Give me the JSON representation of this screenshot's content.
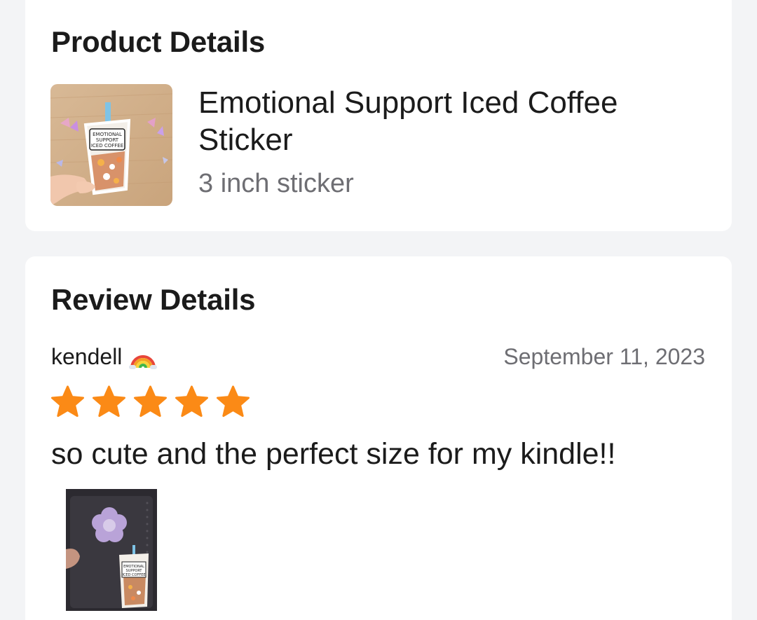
{
  "product_section": {
    "title": "Product Details",
    "product_name": "Emotional Support Iced Coffee Sticker",
    "variant": "3 inch sticker",
    "thumbnail_alt": "Emotional Support Iced Coffee sticker held in hand",
    "sticker_text": [
      "EMOTIONAL",
      "SUPPORT",
      "ICED COFFEE"
    ]
  },
  "review_section": {
    "title": "Review Details",
    "reviewer_name": "kendell",
    "reviewer_emoji": "rainbow-emoji",
    "date": "September 11, 2023",
    "rating": 5,
    "rating_max": 5,
    "review_text": "so cute and the perfect size for my kindle!!",
    "photo_alt": "Sticker applied on a kindle case"
  },
  "colors": {
    "background": "#f3f4f6",
    "card": "#ffffff",
    "star": "#fb8a16",
    "secondary_text": "#6e6e73"
  }
}
